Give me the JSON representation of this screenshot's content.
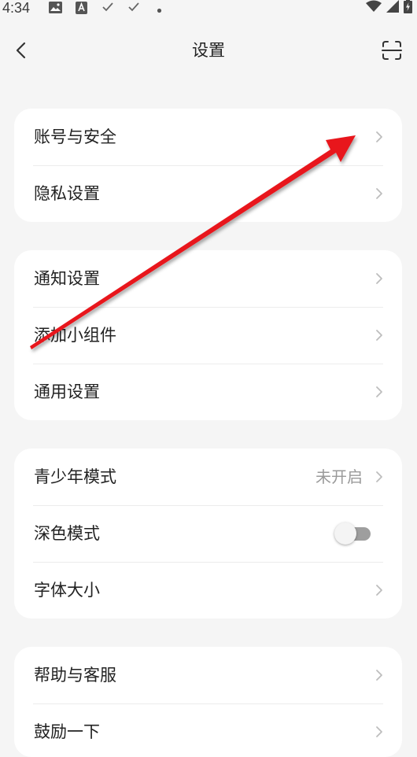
{
  "status_bar": {
    "time": "4:34",
    "icons": [
      "image-icon",
      "font-app-icon",
      "check-icon",
      "check-icon",
      "dot-icon",
      "wifi-icon",
      "signal-icon",
      "battery-charging-icon"
    ]
  },
  "nav": {
    "back_icon": "chevron-left-icon",
    "title": "设置",
    "scan_icon": "scan-icon"
  },
  "groups": [
    {
      "items": [
        {
          "label": "账号与安全"
        },
        {
          "label": "隐私设置"
        }
      ]
    },
    {
      "items": [
        {
          "label": "通知设置"
        },
        {
          "label": "添加小组件"
        },
        {
          "label": "通用设置"
        }
      ]
    },
    {
      "items": [
        {
          "label": "青少年模式",
          "value": "未开启"
        },
        {
          "label": "深色模式",
          "toggle": false
        },
        {
          "label": "字体大小"
        }
      ]
    },
    {
      "items": [
        {
          "label": "帮助与客服"
        },
        {
          "label": "鼓励一下"
        }
      ]
    }
  ],
  "colors": {
    "background": "#f5f5f5",
    "card": "#ffffff",
    "text": "#222222",
    "secondary_text": "#9a9a9a",
    "chevron": "#bdbdbd",
    "toggle_track_off": "#9e9e9e",
    "annotation_arrow": "#e8141c"
  }
}
